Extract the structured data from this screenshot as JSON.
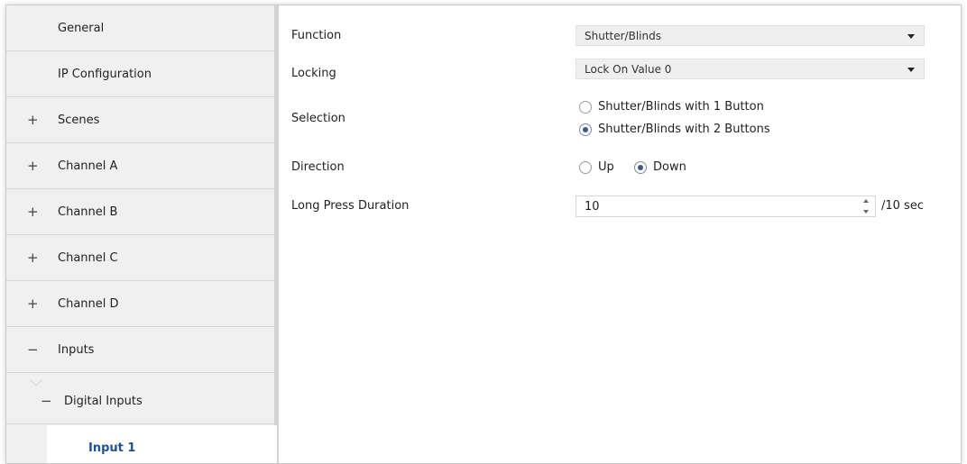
{
  "sidebar": {
    "items": [
      {
        "label": "General",
        "sign": ""
      },
      {
        "label": "IP Configuration",
        "sign": ""
      },
      {
        "label": "Scenes",
        "sign": "+"
      },
      {
        "label": "Channel A",
        "sign": "+"
      },
      {
        "label": "Channel B",
        "sign": "+"
      },
      {
        "label": "Channel C",
        "sign": "+"
      },
      {
        "label": "Channel D",
        "sign": "+"
      },
      {
        "label": "Inputs",
        "sign": "−"
      },
      {
        "label": "Digital Inputs",
        "sign": "−"
      },
      {
        "label": "Input 1",
        "sign": ""
      }
    ],
    "active_color": "#1e4fa1"
  },
  "main": {
    "function": {
      "label": "Function",
      "value": "Shutter/Blinds"
    },
    "locking": {
      "label": "Locking",
      "value": "Lock On Value 0"
    },
    "selection": {
      "label": "Selection",
      "options": [
        {
          "label": "Shutter/Blinds with 1 Button",
          "checked": false
        },
        {
          "label": "Shutter/Blinds with 2 Buttons",
          "checked": true
        }
      ]
    },
    "direction": {
      "label": "Direction",
      "options": [
        {
          "label": "Up",
          "checked": false
        },
        {
          "label": "Down",
          "checked": true
        }
      ]
    },
    "long_press": {
      "label": "Long Press Duration",
      "value": "10",
      "unit": "/10 sec"
    }
  }
}
